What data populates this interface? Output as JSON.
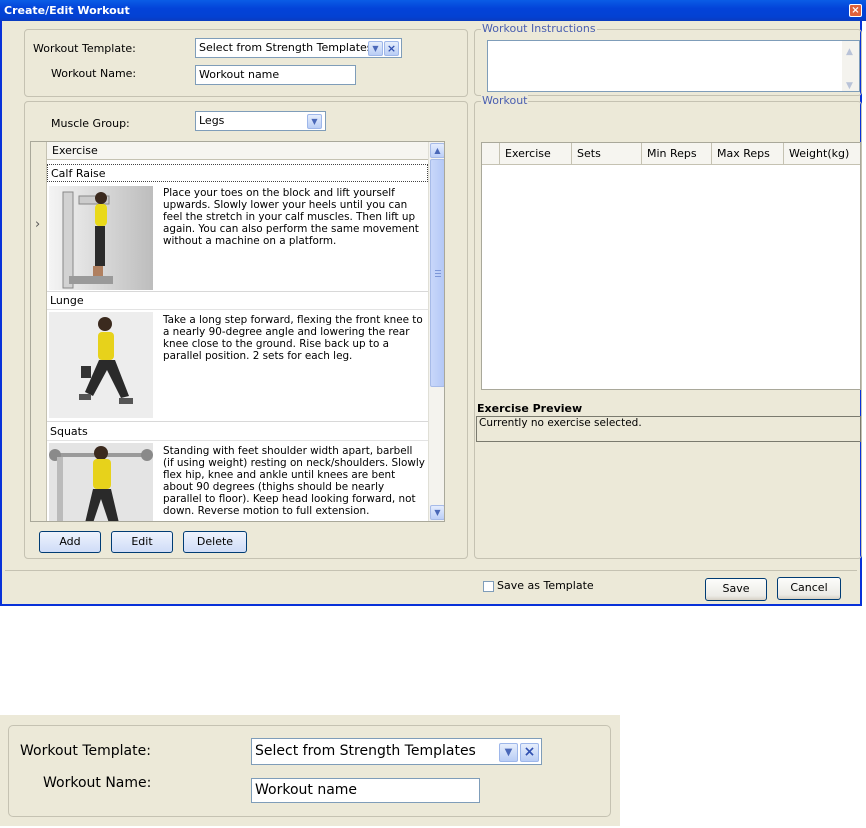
{
  "window": {
    "title": "Create/Edit Workout",
    "close_glyph": "×"
  },
  "template_panel": {
    "template_label": "Workout Template:",
    "template_value": "Select from Strength Templates",
    "name_label": "Workout Name:",
    "name_value": "Workout name"
  },
  "muscle_group": {
    "label": "Muscle Group:",
    "value": "Legs"
  },
  "exercise_grid": {
    "column_header": "Exercise",
    "row_marker": "›",
    "items": [
      {
        "name": "Calf Raise",
        "description": "Place your toes on the block and lift yourself upwards. Slowly lower your heels until you can feel the stretch in your calf muscles. Then lift up again. You can also perform the same movement without a machine on a platform.",
        "image_icon": "calf-raise-figure"
      },
      {
        "name": "Lunge",
        "description": "Take a long step forward, flexing the front knee to a nearly 90-degree angle and lowering the rear knee close to the ground. Rise back up to a parallel position. 2 sets for each leg.",
        "image_icon": "lunge-figure"
      },
      {
        "name": "Squats",
        "description": "Standing with feet shoulder width apart, barbell (if using weight) resting on neck/shoulders. Slowly flex hip, knee and ankle until knees are bent about 90 degrees (thighs should be nearly parallel to floor). Keep head looking forward, not down. Reverse motion to full extension.",
        "image_icon": "squat-figure"
      }
    ]
  },
  "buttons": {
    "add": "Add",
    "edit": "Edit",
    "delete": "Delete",
    "save": "Save",
    "cancel": "Cancel"
  },
  "instructions": {
    "legend": "Workout Instructions",
    "value": ""
  },
  "workout": {
    "legend": "Workout",
    "columns": [
      "Exercise",
      "Sets",
      "Min Reps",
      "Max Reps",
      "Weight(kg)"
    ]
  },
  "preview": {
    "title": "Exercise Preview",
    "text": "Currently no exercise selected."
  },
  "status": {
    "save_as_template_label": "Save as Template",
    "save_as_template_checked": false
  },
  "colors": {
    "titlebar": "#0343d9",
    "window_bg": "#ece9d8",
    "legend_text": "#4a5fb0",
    "frame_border": "#0831d9"
  },
  "zoom_panel": {
    "template_label": "Workout Template:",
    "template_value": "Select from Strength Templates",
    "name_label": "Workout Name:",
    "name_value": "Workout name"
  }
}
